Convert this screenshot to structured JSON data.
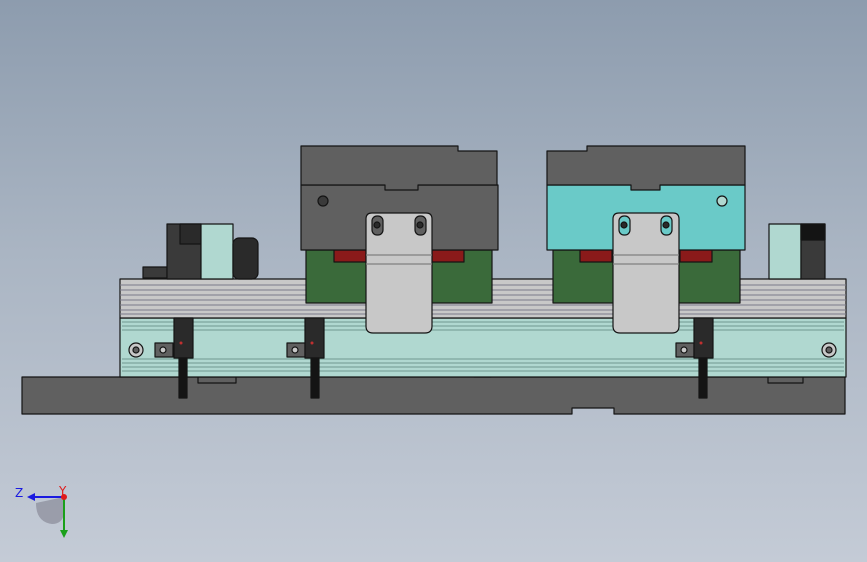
{
  "colors": {
    "background_top": "#8d9cae",
    "background_bottom": "#c4cbd6",
    "dark_gray": "#606060",
    "light_gray": "#c8c8c8",
    "pale_teal": "#b0d8d0",
    "cyan": "#6acac8",
    "green": "#3a6a3a",
    "dark_red": "#8a1a1a",
    "near_black": "#2a2a2a",
    "outline": "#141414"
  },
  "triad": {
    "z_label": "Z",
    "y_label": "Y",
    "z_color": "#1a1ae0",
    "y_color": "#1aa01a",
    "x_color": "#e01a1a"
  },
  "model": {
    "description_icons": [
      "base-plate",
      "fixture-rail",
      "clamp-block-left",
      "clamp-block-right",
      "bracket-left",
      "bracket-right",
      "sensor-1",
      "sensor-2",
      "sensor-3",
      "end-block-left",
      "end-block-right"
    ]
  }
}
